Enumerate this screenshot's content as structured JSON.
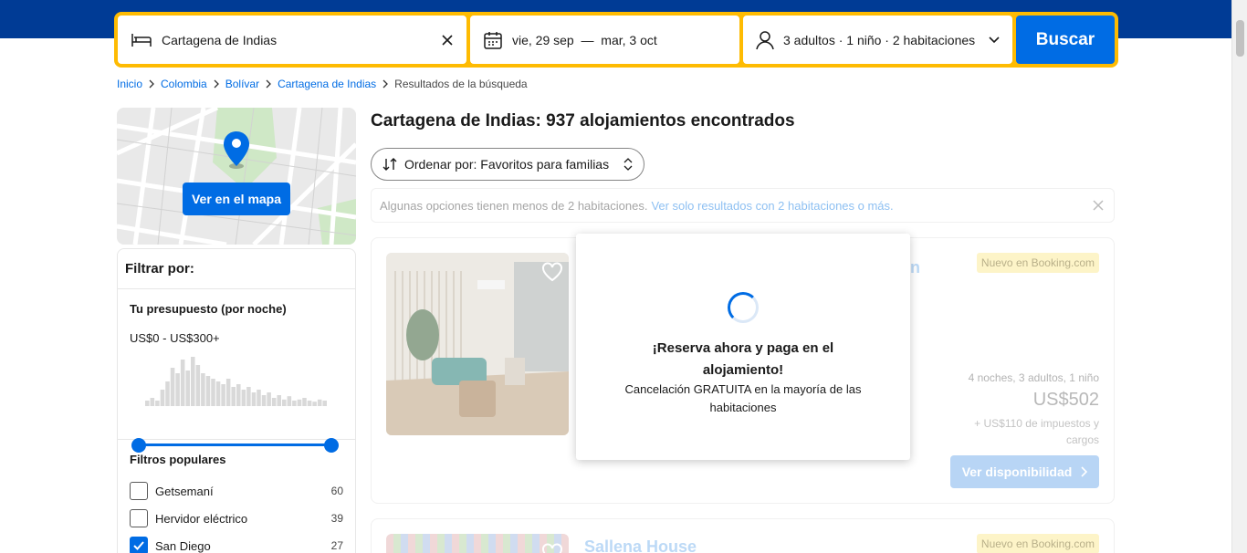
{
  "search": {
    "destination": "Cartagena de Indias",
    "checkin": "vie, 29 sep",
    "dash": "—",
    "checkout": "mar, 3 oct",
    "guests": "3 adultos · 1 niño · 2 habitaciones",
    "button": "Buscar"
  },
  "breadcrumb": [
    "Inicio",
    "Colombia",
    "Bolívar",
    "Cartagena de Indias",
    "Resultados de la búsqueda"
  ],
  "map": {
    "button": "Ver en el mapa"
  },
  "filters": {
    "title": "Filtrar por:",
    "budget_title": "Tu presupuesto (por noche)",
    "budget_range": "US$0 - US$300+",
    "histogram": [
      0.1,
      0.15,
      0.1,
      0.3,
      0.45,
      0.7,
      0.6,
      0.85,
      0.65,
      0.9,
      0.75,
      0.6,
      0.55,
      0.5,
      0.45,
      0.4,
      0.5,
      0.35,
      0.4,
      0.3,
      0.35,
      0.25,
      0.3,
      0.2,
      0.25,
      0.15,
      0.2,
      0.12,
      0.18,
      0.1,
      0.12,
      0.15,
      0.1,
      0.08,
      0.12,
      0.1
    ],
    "popular_title": "Filtros populares",
    "popular": [
      {
        "label": "Getsemaní",
        "count": "60",
        "checked": false
      },
      {
        "label": "Hervidor eléctrico",
        "count": "39",
        "checked": false
      },
      {
        "label": "San Diego",
        "count": "27",
        "checked": true
      }
    ]
  },
  "results": {
    "title": "Cartagena de Indias: 937 alojamientos encontrados",
    "sort": "Ordenar por: Favoritos para familias",
    "notice_text": "Algunas opciones tienen menos de 2 habitaciones.",
    "notice_link": "Ver solo resultados con 2 habitaciones o más."
  },
  "cards": [
    {
      "name": "n",
      "badge": "Nuevo en Booking.com",
      "stay": "4 noches, 3 adultos, 1 niño",
      "price": "US$502",
      "taxes": "+ US$110 de impuestos y cargos",
      "button": "Ver disponibilidad"
    },
    {
      "name": "Sallena House",
      "badge": "Nuevo en Booking.com"
    }
  ],
  "modal": {
    "title": "¡Reserva ahora y paga en el alojamiento!",
    "subtitle": "Cancelación GRATUITA en la mayoría de las habitaciones"
  },
  "colors": {
    "brand_dark": "#003b95",
    "brand_blue": "#006ce4",
    "search_border": "#febb02"
  }
}
